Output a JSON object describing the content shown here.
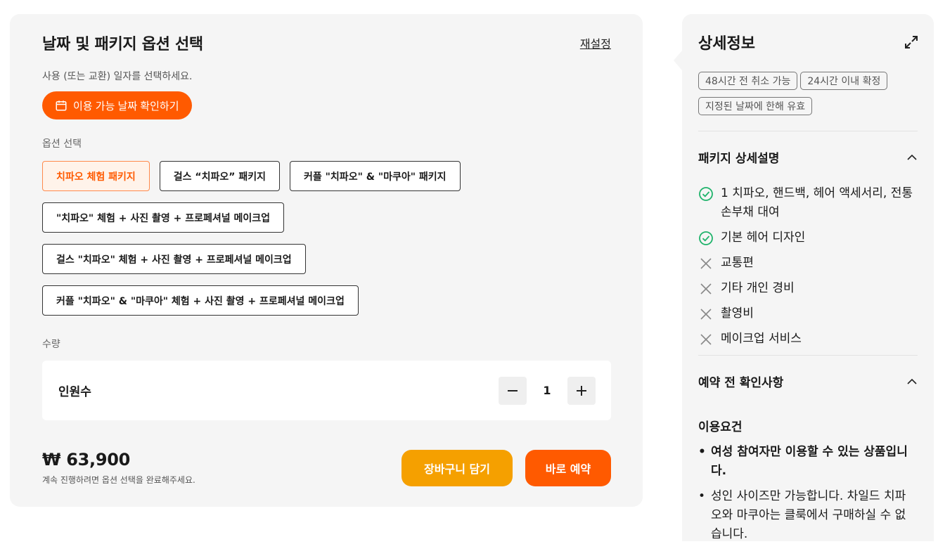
{
  "booking": {
    "title": "날짜 및 패키지 옵션 선택",
    "reset_label": "재설정",
    "date_prompt": "사용 (또는 교환) 일자를 선택하세요.",
    "date_button": "이용 가능 날짜 확인하기",
    "options_label": "옵션 선택",
    "options": [
      [
        "치파오 체험 패키지",
        "걸스 “치파오” 패키지",
        "커플 \"치파오\" & \"마쿠아\" 패키지"
      ],
      [
        "\"치파오\" 체험 + 사진 촬영 + 프로페셔널 메이크업"
      ],
      [
        "걸스 \"치파오\" 체험 + 사진 촬영 + 프로페셔널 메이크업"
      ],
      [
        "커플 \"치파오\" & \"마쿠아\" 체험 + 사진 촬영 + 프로페셔널 메이크업"
      ]
    ],
    "selected_option": "치파오 체험 패키지",
    "quantity_label": "수량",
    "quantity_item": "인원수",
    "quantity_value": "1",
    "price": "₩ 63,900",
    "price_note": "계속 진행하려면 옵션 선택을 완료해주세요.",
    "cart_button": "장바구니 담기",
    "book_button": "바로 예약"
  },
  "details": {
    "title": "상세정보",
    "tags": [
      "48시간 전 취소 가능",
      "24시간 이내 확정",
      "지정된 날짜에 한해 유효"
    ],
    "package_section_title": "패키지 상세설명",
    "features": [
      {
        "text": "1 치파오, 핸드백, 헤어 액세서리, 전통 손부채 대여",
        "included": true
      },
      {
        "text": "기본 헤어 디자인",
        "included": true
      },
      {
        "text": "교통편",
        "included": false
      },
      {
        "text": "기타 개인 경비",
        "included": false
      },
      {
        "text": "촬영비",
        "included": false
      },
      {
        "text": "메이크업 서비스",
        "included": false
      }
    ],
    "notice_section_title": "예약 전 확인사항",
    "requirements_title": "이용요건",
    "requirements": [
      {
        "text": "여성 참여자만 이용할 수 있는 상품입니다.",
        "strong": true
      },
      {
        "text": "성인 사이즈만 가능합니다. 차일드 치파오와 마쿠아는 클룩에서 구매하실 수 없습니다.",
        "strong": false
      }
    ]
  },
  "colors": {
    "accent": "#ff5a00",
    "cart": "#f5a000",
    "included": "#1fb36b",
    "excluded": "#888888"
  }
}
